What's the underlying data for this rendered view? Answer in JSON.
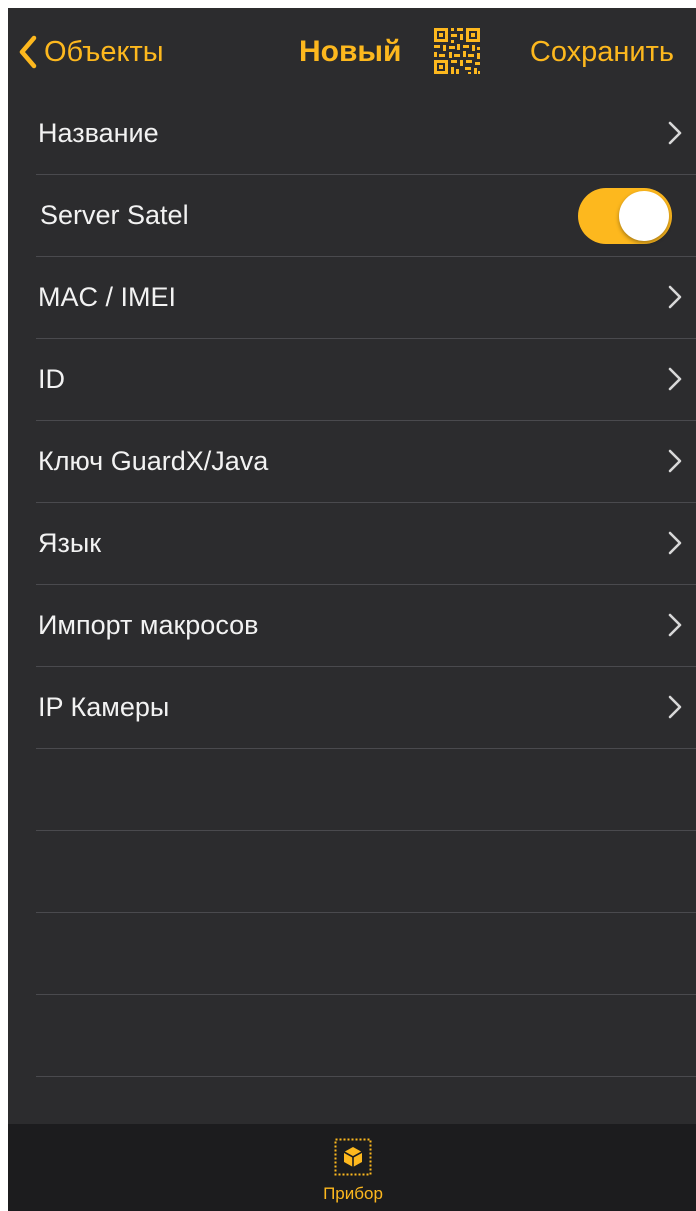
{
  "colors": {
    "accent": "#fdb81e",
    "background": "#2c2c2e",
    "tabbar_background": "#1c1c1e",
    "text": "#f2f2f2",
    "separator": "#4a4a4e"
  },
  "navbar": {
    "back_label": "Объекты",
    "back_icon": "chevron-left-icon",
    "title": "Новый",
    "qr_icon": "qr-code-icon",
    "save_label": "Сохранить"
  },
  "list": {
    "items": [
      {
        "label": "Название",
        "control": "disclosure"
      },
      {
        "label": "Server Satel",
        "control": "toggle",
        "toggle_on": true
      },
      {
        "label": "MAC / IMEI",
        "control": "disclosure"
      },
      {
        "label": "ID",
        "control": "disclosure"
      },
      {
        "label": "Ключ GuardX/Java",
        "control": "disclosure"
      },
      {
        "label": "Язык",
        "control": "disclosure"
      },
      {
        "label": "Импорт макросов",
        "control": "disclosure"
      },
      {
        "label": "IP Камеры",
        "control": "disclosure"
      }
    ]
  },
  "tabbar": {
    "tabs": [
      {
        "label": "Прибор",
        "icon": "device-box-icon",
        "selected": true
      }
    ]
  }
}
